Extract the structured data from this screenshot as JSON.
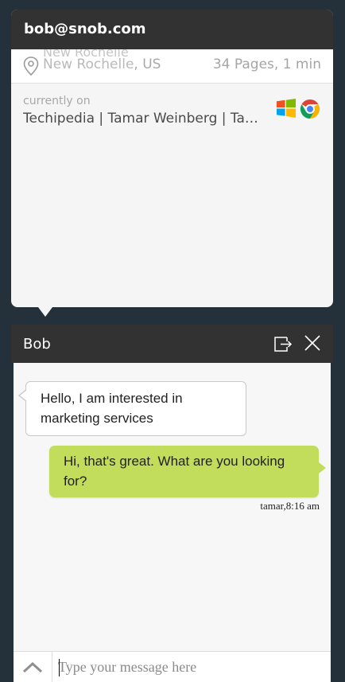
{
  "visitor": {
    "email": "bob@snob.com",
    "city_previous": "New Rochelle",
    "city": "New Rochelle",
    "region": ", US",
    "visit_stats": "34 Pages, 1 min",
    "current_label": "currently on",
    "current_page": "Techipedia | Tamar Weinberg | Ta…",
    "os_icon": "windows-icon",
    "browser_icon": "chrome-icon"
  },
  "chat": {
    "title": "Bob",
    "popout_icon": "popout-icon",
    "close_icon": "close-icon",
    "messages": [
      {
        "direction": "incoming",
        "text": "Hello, I am interested in marketing services"
      },
      {
        "direction": "outgoing",
        "text": "Hi, that's great. What are you looking for?",
        "meta": "tamar,8:16 am"
      }
    ],
    "input_placeholder": "Type your message here",
    "input_value": "",
    "expand_icon": "chevron-up-icon"
  },
  "colors": {
    "page_background": "#25313a",
    "header_background": "#323232",
    "card_background": "#f5f5f5",
    "incoming_bubble": "#ffffff",
    "outgoing_bubble": "#c2dd5c"
  }
}
